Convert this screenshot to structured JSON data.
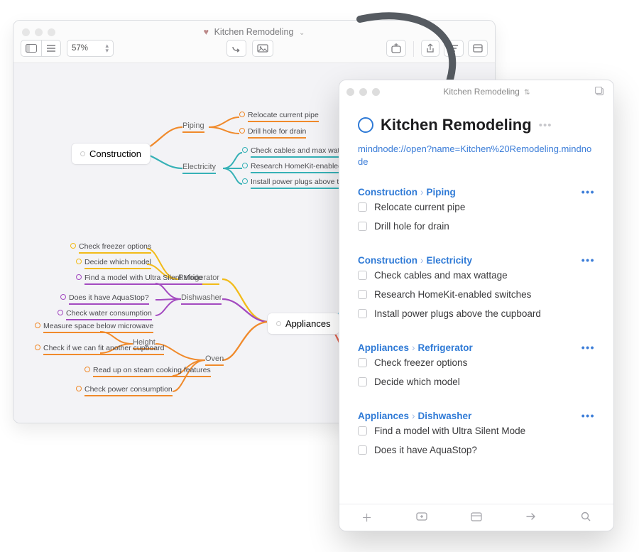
{
  "mindnode": {
    "title": "Kitchen Remodeling",
    "zoom": "57%",
    "root_left": "Construction",
    "root_right": "Appliances",
    "branches": {
      "piping": "Piping",
      "electricity": "Electricity",
      "refrigerator": "Refrigerator",
      "dishwasher": "Dishwasher",
      "oven": "Oven",
      "height": "Height"
    },
    "leaves": {
      "piping": [
        "Relocate current pipe",
        "Drill hole for drain"
      ],
      "electricity": [
        "Check cables and max wattage",
        "Research HomeKit-enabled swit",
        "Install power plugs above the cu"
      ],
      "refrigerator": [
        "Check freezer options",
        "Decide which model"
      ],
      "dishwasher": [
        "Find a model with Ultra Silent Mode",
        "Does it have AquaStop?",
        "Check water consumption"
      ],
      "height": [
        "Measure space below microwave",
        "Check if we can fit another cupboard"
      ],
      "oven": [
        "Read up on steam cooking features",
        "Check power consumption"
      ]
    }
  },
  "things": {
    "title": "Kitchen Remodeling",
    "project_title": "Kitchen Remodeling",
    "link": "mindnode://open?name=Kitchen%20Remodeling.mindnode",
    "sections": [
      {
        "crumb1": "Construction",
        "crumb2": "Piping",
        "tasks": [
          "Relocate current pipe",
          "Drill hole for drain"
        ]
      },
      {
        "crumb1": "Construction",
        "crumb2": "Electricity",
        "tasks": [
          "Check cables and max wattage",
          "Research HomeKit-enabled switches",
          "Install power plugs above the cupboard"
        ]
      },
      {
        "crumb1": "Appliances",
        "crumb2": "Refrigerator",
        "tasks": [
          "Check freezer options",
          "Decide which model"
        ]
      },
      {
        "crumb1": "Appliances",
        "crumb2": "Dishwasher",
        "tasks": [
          "Find a model with Ultra Silent Mode",
          "Does it have AquaStop?"
        ]
      }
    ]
  }
}
